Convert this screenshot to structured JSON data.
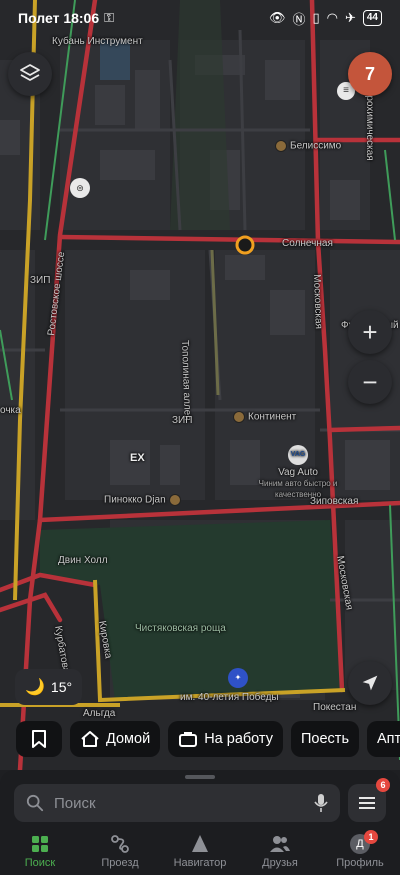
{
  "status_bar": {
    "time_label": "Полет 18:06",
    "battery": "44"
  },
  "map": {
    "labels": {
      "kuban": "Кубань Инструмент",
      "belissimo": "Белиссимо",
      "solnechnaya": "Солнечная",
      "zip_top": "ЗИП",
      "topolinaya": "Тополиная аллея",
      "moskovskaya_top": "Московская",
      "futbolny": "Футбольный",
      "rostovskoe": "Ростовское шоссе",
      "ochka": "очка",
      "zip_mid": "ЗИП",
      "kontinent": "Континент",
      "vag_title": "Vag Auto",
      "vag_sub": "Чиним авто быстро и качественно",
      "ex": "EX",
      "pinokkio": "Пинокко Djan",
      "zipovskaya": "Зиповская",
      "dvin": "Двин Холл",
      "kurgatova": "Курбатова",
      "kirovka": "Кировка",
      "chistyak": "Чистяковская роща",
      "moskovskaya_bot": "Московская",
      "albda": "Альгда",
      "pobedy": "им. 40-летия Победы",
      "pokestan": "Покестан",
      "akroz": "Агрохимическая"
    }
  },
  "notification_count": "7",
  "weather": {
    "temp": "15°",
    "icon": "moon-cloud-icon"
  },
  "chips": [
    {
      "label": "",
      "icon": "bookmark-icon"
    },
    {
      "label": "Домой",
      "icon": "home-icon"
    },
    {
      "label": "На работу",
      "icon": "briefcase-icon"
    },
    {
      "label": "Поесть",
      "icon": ""
    },
    {
      "label": "Апт",
      "icon": ""
    }
  ],
  "search": {
    "placeholder": "Поиск"
  },
  "menu_badge": "6",
  "tabs": [
    {
      "label": "Поиск",
      "icon": "grid-icon",
      "active": true
    },
    {
      "label": "Проезд",
      "icon": "route-icon",
      "active": false
    },
    {
      "label": "Навигатор",
      "icon": "navigator-icon",
      "active": false
    },
    {
      "label": "Друзья",
      "icon": "friends-icon",
      "active": false
    },
    {
      "label": "Профиль",
      "icon": "profile-icon",
      "active": false,
      "badge": "1",
      "initial": "Д"
    }
  ],
  "colors": {
    "accent_green": "#4caf50",
    "traffic_red": "#b8323a",
    "road_yellow": "#c9a227",
    "notif_orange": "#c4553b"
  }
}
